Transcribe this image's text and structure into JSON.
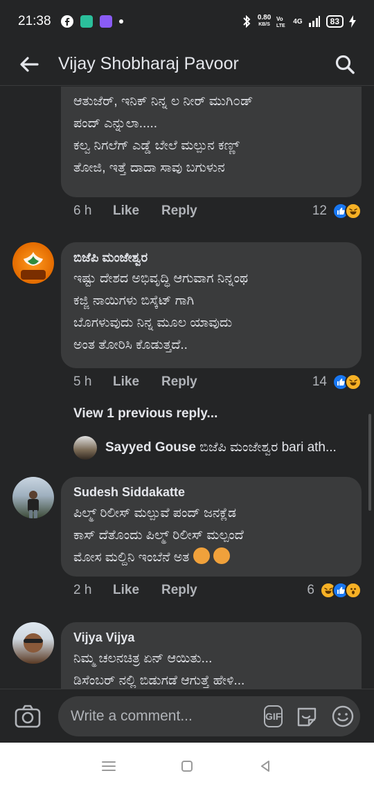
{
  "status_bar": {
    "time": "21:38",
    "net_speed_value": "0.80",
    "net_speed_unit": "KB/S",
    "network": "4G",
    "battery": "83",
    "icons": [
      "facebook-icon",
      "app-icon",
      "app-icon-2",
      "notification-dot",
      "bluetooth-icon",
      "volte-icon",
      "signal-icon",
      "battery-icon"
    ]
  },
  "header": {
    "title": "Vijay Shobharaj Pavoor",
    "back_icon": "arrow-left-icon",
    "search_icon": "search-icon"
  },
  "comments": [
    {
      "author": "",
      "text": "ಆತುಜೆರ್, ಇನಿಕ್ ನಿನ್ನ ಲ ನೀರ್ ಮುಗಿ೦ಡ್\nಪಂದ್ ಎನ್ನುಲಾ.....\n ಕಲ್ವ ನಿಗಲೆಗ್ ಎಡ್ಡೆ ಬೇಲೆ ಮಲ್ಪುನ ಕಣ್ಣ್\nತೋಜಿ, ಇತ್ತೆ ದಾದಾ ಸಾವು ಬಗುಳುನ",
      "time": "6 h",
      "like": "Like",
      "reply": "Reply",
      "reaction_count": "12"
    },
    {
      "author": "ಬಿಜೆಪಿ ಮಂಜೇಶ್ವರ",
      "text": "ಇಷ್ಟು ದೇಶದ ಅಭಿವೃದ್ಧಿ ಆಗುವಾಗ ನಿನ್ನಂಥ\nಕಜ್ಜಿ ನಾಯಿಗಳು ಬಿಸ್ಕೆಟ್ ಗಾಗಿ\nಬೊಗಳುವುದು ನಿನ್ನ ಮೂಲ ಯಾವುದು\nಅಂತ ತೋರಿಸಿ ಕೊಡುತ್ತದೆ..",
      "time": "5 h",
      "like": "Like",
      "reply": "Reply",
      "reaction_count": "14",
      "view_previous": "View 1 previous reply...",
      "reply_preview_author": "Sayyed Gouse",
      "reply_preview_text": " ಬಿಜೆಪಿ ಮಂಜೇಶ್ವರ bari ath..."
    },
    {
      "author": "Sudesh Siddakatte",
      "text": "ಪಿಲ್ಮ್ ರಿಲೀಸ್ ಮಲ್ಪುವೆ ಪಂದ್ ಜನಕ್ಲೆಡ\nಕಾಸ್ ದೆತೊಂದು ಪಿಲ್ಮ್ ರಿಲೀಸ್ ಮಲ್ಪಂದೆ\nಮೋಸ ಮಲ್ದಿನಿ ಇಂಬೆನೆ ಅತ",
      "time": "2 h",
      "like": "Like",
      "reply": "Reply",
      "reaction_count": "6"
    },
    {
      "author": "Vijya Vijya",
      "text": "ನಿಮ್ಮ ಚಲನಚಿತ್ರ ಏನ್ ಆಯಿತು...\nಡಿಸೆಂಬರ್ ನಲ್ಲಿ ಬಿಡುಗಡೆ ಆಗುತ್ತೆ ಹೇಳಿ..."
    }
  ],
  "composer": {
    "placeholder": "Write a comment...",
    "gif_label": "GIF"
  },
  "colors": {
    "background": "#242526",
    "bubble": "#3a3b3c",
    "like_blue": "#1877f2",
    "haha_yellow": "#f7b125",
    "secondary_text": "#b0b3b8"
  }
}
